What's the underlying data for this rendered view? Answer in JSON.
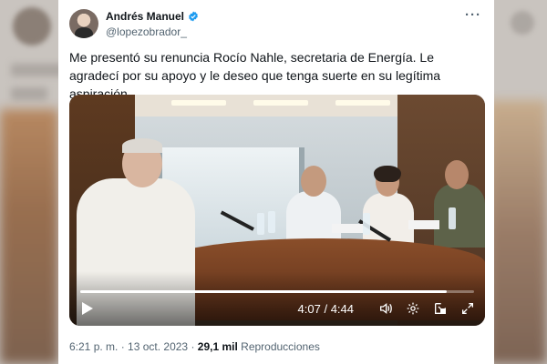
{
  "author": {
    "name": "Andrés Manuel",
    "handle": "@lopezobrador_"
  },
  "tweet": {
    "text": "Me presentó su renuncia Rocío Nahle, secretaria de Energía. Le agradecí por su apoyo y le deseo que tenga suerte en su legítima aspiración."
  },
  "menu": {
    "more_label": "···"
  },
  "video": {
    "current_time": "4:07",
    "separator": " / ",
    "duration": "4:44",
    "progress_fraction": 0.93,
    "icons": [
      "play-icon",
      "volume-icon",
      "settings-icon",
      "picture-in-picture-icon",
      "fullscreen-icon"
    ]
  },
  "meta": {
    "time": "6:21 p. m.",
    "dot1": " · ",
    "date": "13 oct. 2023",
    "dot2": " · ",
    "views_count": "29,1 mil",
    "views_label": " Reproducciones"
  },
  "colors": {
    "verified": "#1d9bf0",
    "text": "#0f1419",
    "muted": "#536471"
  }
}
